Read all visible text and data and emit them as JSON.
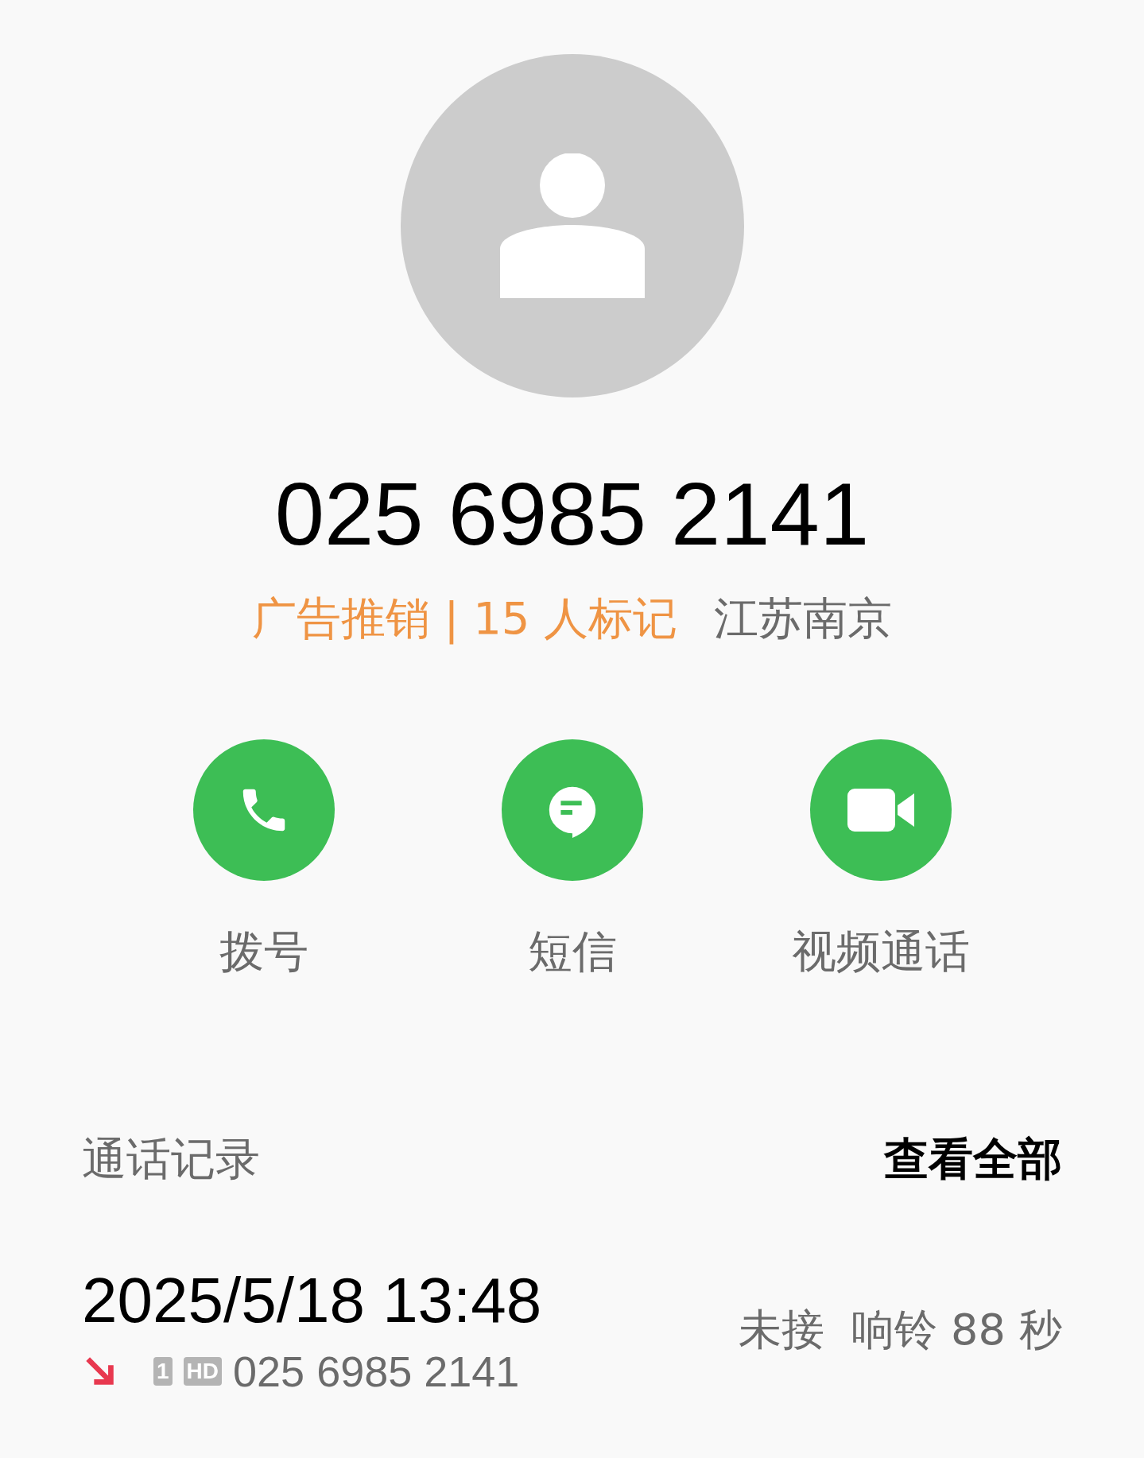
{
  "contact": {
    "number": "025 6985 2141",
    "tag": "广告推销 | 15 人标记",
    "location": "江苏南京"
  },
  "actions": [
    {
      "kind": "call",
      "label": "拨号"
    },
    {
      "kind": "message",
      "label": "短信"
    },
    {
      "kind": "video",
      "label": "视频通话"
    }
  ],
  "call_log": {
    "title": "通话记录",
    "view_all": "查看全部",
    "entries": [
      {
        "datetime": "2025/5/18 13:48",
        "kind": "missed",
        "sim": "1",
        "hd": "HD",
        "number": "025 6985 2141",
        "status": "未接  响铃 88 秒"
      }
    ]
  }
}
